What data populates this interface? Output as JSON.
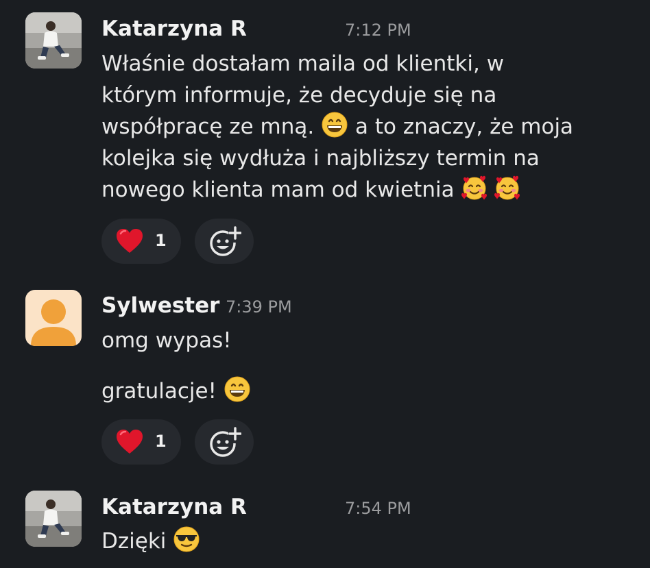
{
  "messages": [
    {
      "author": "Katarzyna R",
      "time": "7:12 PM",
      "lines": [
        "Właśnie dostałam maila od klientki, w",
        "którym informuje, że decyduje się na",
        "współpracę ze mną.",
        "a to znaczy, że moja",
        "kolejka się wydłuża i najbliższy termin na",
        "nowego klienta mam od kwietnia"
      ],
      "emojis": [
        "grinning-face-emoji",
        "smiling-face-with-hearts-emoji",
        "smiling-face-with-hearts-emoji"
      ],
      "reaction": {
        "icon": "red-heart-emoji",
        "count": "1"
      }
    },
    {
      "author": "Sylwester",
      "time": "7:39 PM",
      "lines": [
        "omg wypas!",
        "gratulacje!"
      ],
      "emojis": [
        "grinning-face-emoji"
      ],
      "reaction": {
        "icon": "red-heart-emoji",
        "count": "1"
      }
    },
    {
      "author": "Katarzyna R",
      "time": "7:54 PM",
      "lines": [
        "Dzięki"
      ],
      "emojis": [
        "sunglasses-face-emoji"
      ]
    }
  ],
  "icons": {
    "add_reaction": "add-reaction-icon"
  },
  "colors": {
    "background": "#1a1d21",
    "pill": "#26292e",
    "text": "#e8e8e8",
    "timestamp": "#9b9c9e",
    "heart": "#e0162b",
    "default_avatar_bg": "#fbe3c7",
    "default_avatar_figure": "#f0a13a"
  }
}
